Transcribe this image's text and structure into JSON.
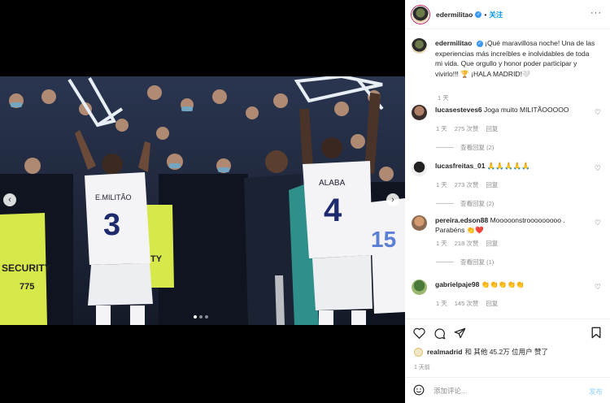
{
  "post": {
    "username": "edermilitao",
    "follow_label": "关注",
    "caption": "¡Qué maravillosa noche! Una de las experiencias más increíbles e inolvidables de toda mi vida. Que orgullo y honor poder participar y vivirlo!!! 🏆 ¡HALA MADRID!🤍",
    "caption_time": "1 天",
    "media": {
      "jersey_left": "E.MILITÃO",
      "number_left": "3",
      "jersey_right": "ALABA",
      "number_right": "4",
      "vest_text_1": "SECURITY",
      "vest_number": "775",
      "vest_text_2": "RITY",
      "number_far_right": "15",
      "carousel_dots": 3,
      "active_dot": 0
    }
  },
  "comments": [
    {
      "user": "lucasesteves6",
      "text": "Joga muito MILITÃOOOOO",
      "time": "1 天",
      "likes": "275 次赞",
      "reply": "回复",
      "view_replies": "查看回复 (2)"
    },
    {
      "user": "lucasfreitas_01",
      "text": "🙏🙏🙏🙏🙏",
      "time": "1 天",
      "likes": "273 次赞",
      "reply": "回复",
      "view_replies": "查看回复 (2)"
    },
    {
      "user": "pereira.edson88",
      "text": "Mooooonstrooooooooo . Parabéns 👏❤️",
      "time": "1 天",
      "likes": "218 次赞",
      "reply": "回复",
      "view_replies": "查看回复 (1)"
    },
    {
      "user": "gabrielpaje98",
      "text": "👏👏👏👏👏",
      "time": "1 天",
      "likes": "145 次赞",
      "reply": "回复",
      "view_replies": ""
    }
  ],
  "actions": {
    "liked_by_user": "realmadrid",
    "liked_by_rest": "和 其他 45.2万 位用户 赞了",
    "date": "1 天前"
  },
  "add_comment": {
    "placeholder": "添加评论...",
    "post_label": "发布"
  }
}
